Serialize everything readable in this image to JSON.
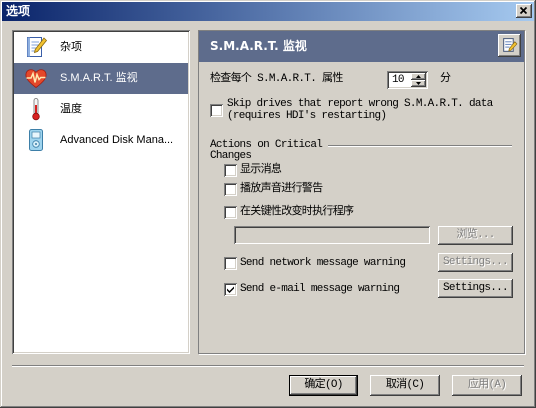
{
  "window": {
    "title": "选项",
    "close_icon": "close-icon"
  },
  "sidebar": {
    "items": [
      {
        "label": "杂项",
        "icon": "checklist-icon",
        "selected": false
      },
      {
        "label": "S.M.A.R.T. 监视",
        "icon": "heart-monitor-icon",
        "selected": true
      },
      {
        "label": "温度",
        "icon": "thermometer-icon",
        "selected": false
      },
      {
        "label": "Advanced Disk Mana...",
        "icon": "disk-device-icon",
        "selected": false
      }
    ]
  },
  "panel": {
    "title": "S.M.A.R.T. 监视",
    "header_icon": "notes-edit-icon",
    "interval": {
      "label": "检查每个 S.M.A.R.T. 属性",
      "value": "10",
      "unit": "分"
    },
    "skip_drives": {
      "line1": "Skip drives that report wrong S.M.A.R.T. data",
      "line2": "(requires HDI's restarting)",
      "checked": false
    },
    "actions": {
      "title_line1": "Actions on Critical",
      "title_line2": "Changes",
      "show_message": {
        "label": "显示消息",
        "checked": false
      },
      "play_sound": {
        "label": "播放声音进行警告",
        "checked": false
      },
      "run_program": {
        "label": "在关键性改变时执行程序",
        "checked": false,
        "browse_label": "浏览...",
        "browse_enabled": false
      },
      "network_warning": {
        "label": "Send network message warning",
        "checked": false,
        "settings_label": "Settings...",
        "settings_enabled": false
      },
      "email_warning": {
        "label": "Send e-mail message warning",
        "checked": true,
        "settings_label": "Settings...",
        "settings_enabled": true
      }
    }
  },
  "footer": {
    "ok_label": "确定(O)",
    "cancel_label": "取消(C)",
    "apply_label": "应用(A)",
    "apply_enabled": false
  },
  "colors": {
    "face": "#D4D0C8",
    "title_start": "#0A246A",
    "title_end": "#A6CAF0",
    "selection": "#5E6C8C",
    "header": "#5E6C8C",
    "disabled_text": "#808080"
  }
}
